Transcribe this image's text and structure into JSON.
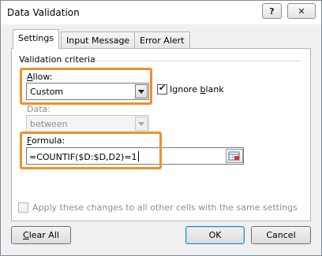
{
  "window": {
    "title": "Data Validation",
    "help_label": "?",
    "close_label": "✕"
  },
  "tabs": [
    {
      "label": "Settings",
      "active": true
    },
    {
      "label": "Input Message",
      "active": false
    },
    {
      "label": "Error Alert",
      "active": false
    }
  ],
  "settings": {
    "section_label": "Validation criteria",
    "allow": {
      "label_key": "A",
      "label_rest": "llow:",
      "value": "Custom"
    },
    "ignore_blank": {
      "label_pre": "Ignore ",
      "label_key": "b",
      "label_post": "lank",
      "checked": true
    },
    "data": {
      "label": "Data:",
      "value": "between"
    },
    "formula": {
      "label_key": "F",
      "label_rest": "ormula:",
      "value": "=COUNTIF($D:$D,D2)=1"
    },
    "apply_all": {
      "label": "Apply these changes to all other cells with the same settings",
      "checked": false
    }
  },
  "buttons": {
    "clear_all_key": "C",
    "clear_all_rest": "lear All",
    "ok": "OK",
    "cancel": "Cancel"
  },
  "colors": {
    "highlight": "#f0902a",
    "title_bar": "#ffffff",
    "dialog_bg": "#f0f0f0"
  }
}
